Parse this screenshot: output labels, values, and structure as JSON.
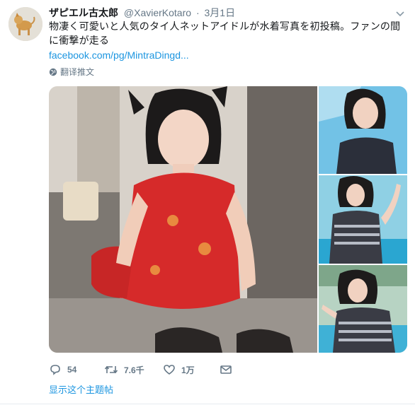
{
  "tweet": {
    "author_name": "ザピエル古太郎",
    "author_handle": "@XavierKotaro",
    "separator": "·",
    "date": "3月1日",
    "text": "物凄く可愛いと人気のタイ人ネットアイドルが水着写真を初投稿。ファンの間に衝撃が走る",
    "link_text": "facebook.com/pg/MintraDingd...",
    "translate_label": "翻译推文",
    "thread_label": "显示这个主题帖"
  },
  "actions": {
    "reply_count": "54",
    "retweet_count": "7.6千",
    "like_count": "1万"
  },
  "icons": {
    "globe": "globe-icon",
    "reply": "reply-icon",
    "retweet": "retweet-icon",
    "like": "heart-icon",
    "dm": "envelope-icon",
    "caret": "chevron-down-icon"
  },
  "colors": {
    "link": "#1b95e0",
    "muted": "#657786",
    "text": "#14171a"
  }
}
